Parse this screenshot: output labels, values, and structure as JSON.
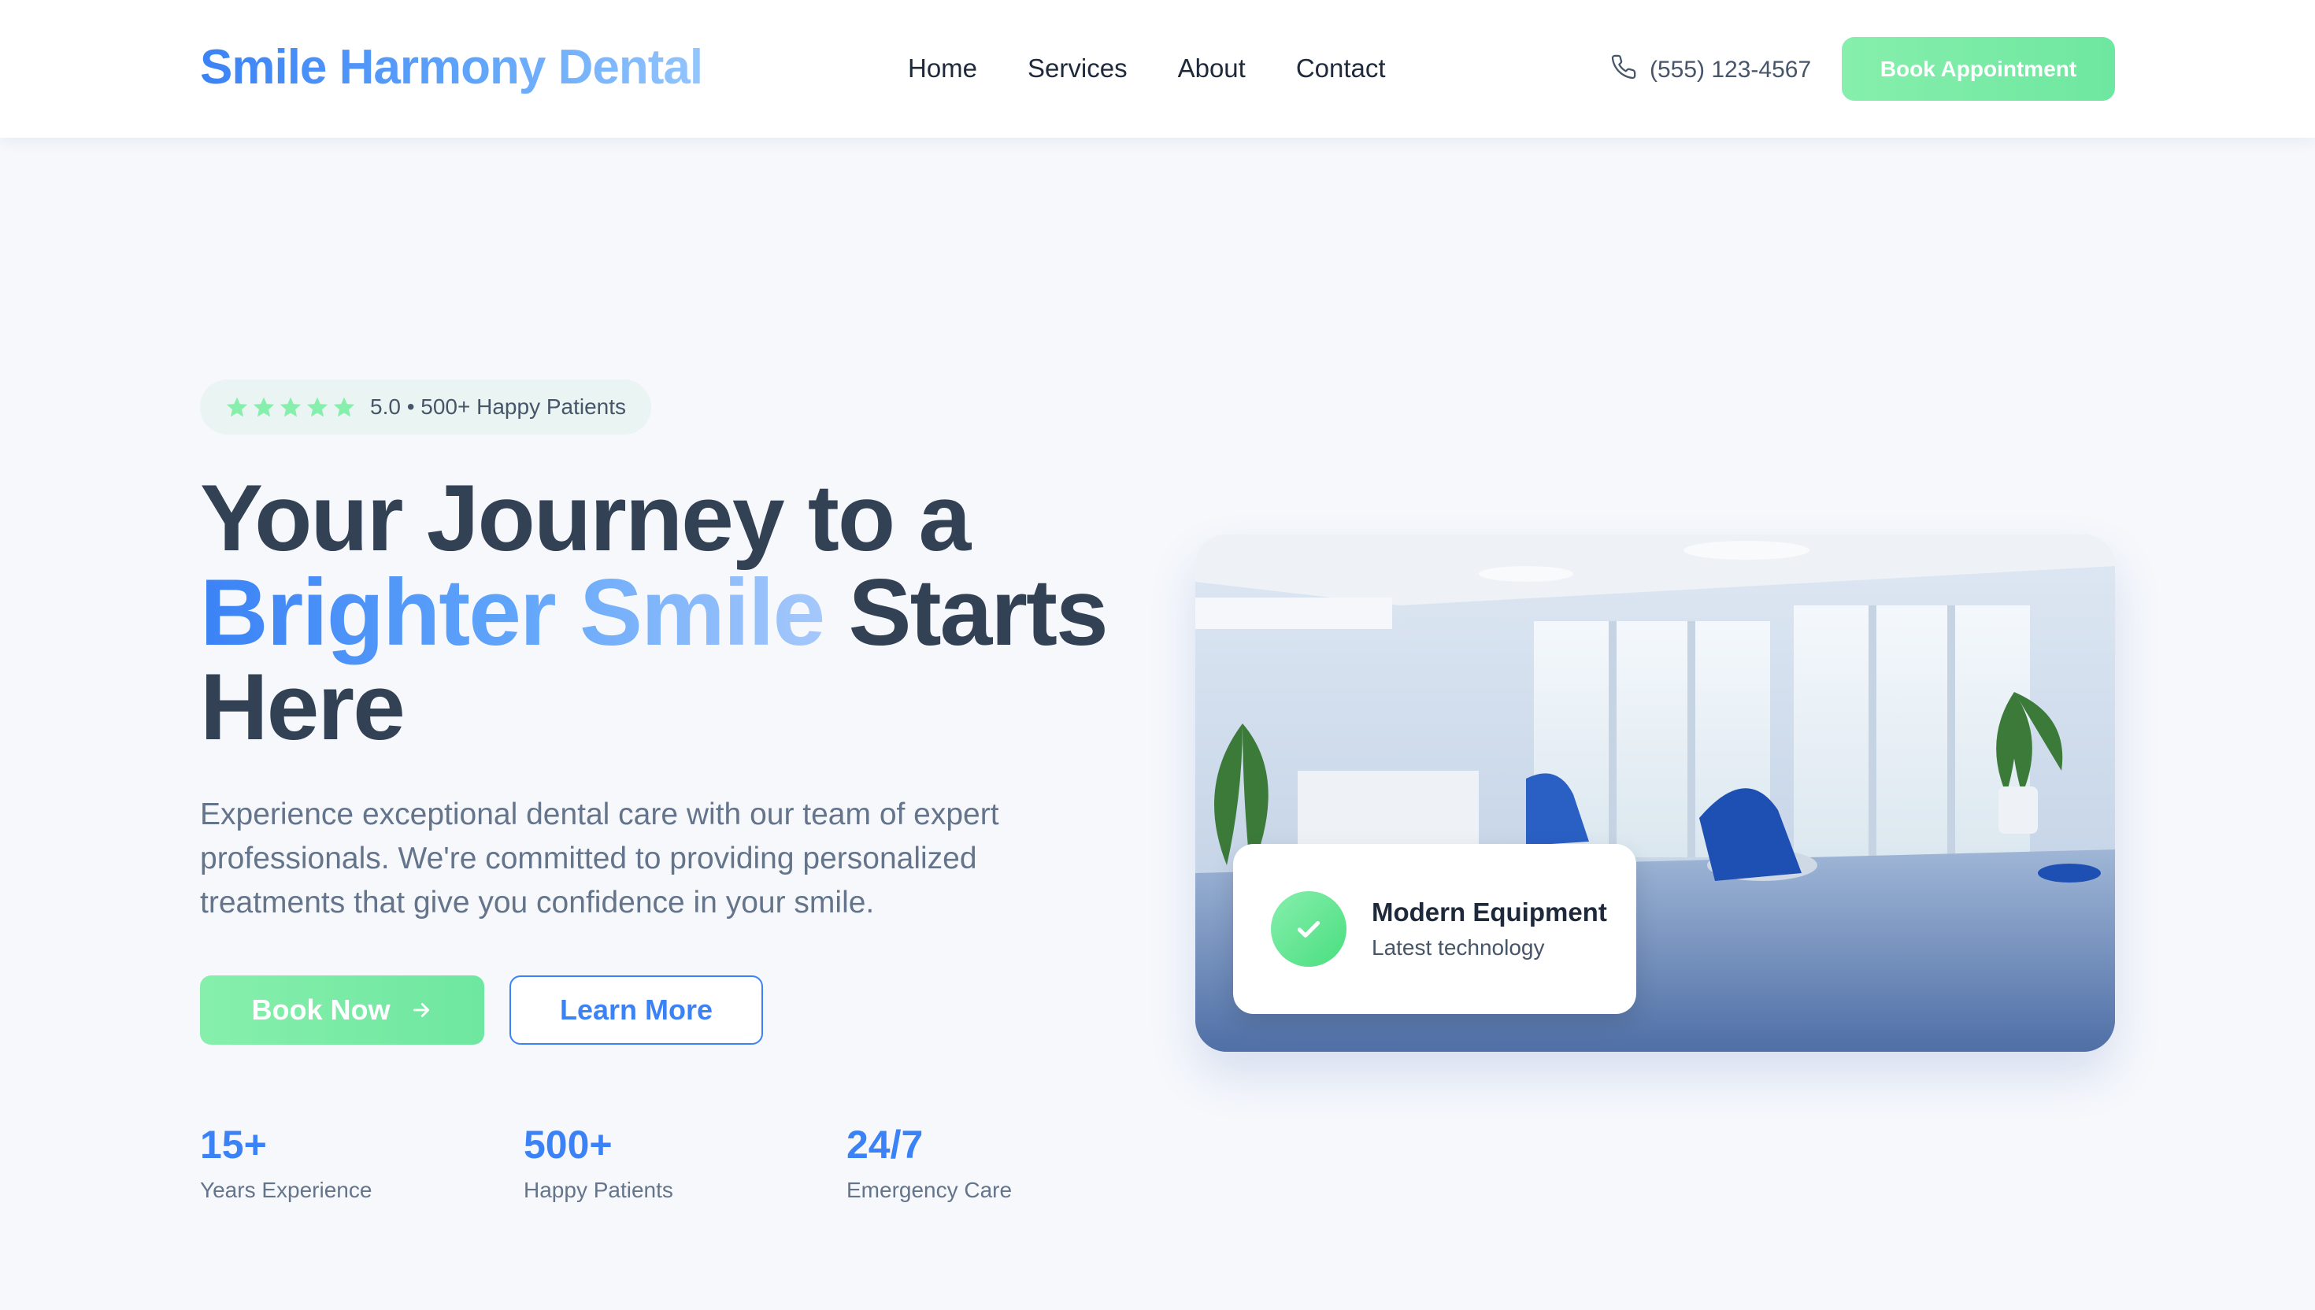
{
  "header": {
    "logo": "Smile Harmony Dental",
    "nav": [
      "Home",
      "Services",
      "About",
      "Contact"
    ],
    "phone": "(555) 123-4567",
    "book_label": "Book Appointment",
    "phone_icon": "phone-icon"
  },
  "hero": {
    "badge_text": "5.0 • 500+ Happy Patients",
    "rating": 5,
    "star_icon": "star-icon",
    "title_line1": "Your Journey to a",
    "title_highlight": "Brighter Smile",
    "title_rest": "Starts",
    "title_line3": "Here",
    "description": "Experience exceptional dental care with our team of expert professionals. We're committed to providing personalized treatments that give you confidence in your smile.",
    "book_now": "Book Now",
    "learn_more": "Learn More",
    "arrow_icon": "arrow-right-icon"
  },
  "stats": [
    {
      "value": "15+",
      "label": "Years Experience"
    },
    {
      "value": "500+",
      "label": "Happy Patients"
    },
    {
      "value": "24/7",
      "label": "Emergency Care"
    }
  ],
  "feature_card": {
    "title": "Modern Equipment",
    "subtitle": "Latest technology",
    "icon": "check-icon"
  },
  "colors": {
    "brand_blue": "#3b82f6",
    "accent_green": "#86efac",
    "background": "#f6f8fc"
  }
}
